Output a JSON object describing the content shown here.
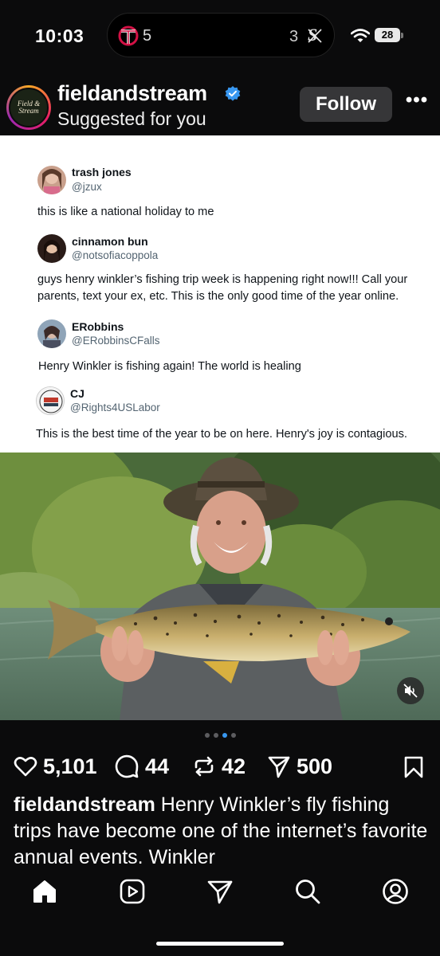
{
  "status_bar": {
    "time": "10:03",
    "live_activity": {
      "left_score": "5",
      "right_score": "3",
      "left_team_icon": "twins-logo-icon",
      "right_team_icon": "white-sox-logo-icon"
    },
    "battery": "28"
  },
  "post": {
    "username": "fieldandstream",
    "subtitle": "Suggested for you",
    "follow_label": "Follow",
    "more_label": "•••",
    "avatar_text": [
      "Field &",
      "Stream"
    ]
  },
  "tweets": [
    {
      "name": "trash jones",
      "handle": "@jzux",
      "text": "this is like a national holiday to me"
    },
    {
      "name": "cinnamon bun",
      "handle": "@notsofiacoppola",
      "text": "guys henry winkler’s fishing trip week is happening right now!!! Call your parents, text your ex, etc. This is the only good time of the year online."
    },
    {
      "name": "ERobbins",
      "handle": "@ERobbinsCFalls",
      "text": "Henry Winkler is fishing again! The world is healing"
    },
    {
      "name": "CJ",
      "handle": "@Rights4USLabor",
      "text": "This is the best time of the year to be on here. Henry's joy is contagious."
    }
  ],
  "carousel": {
    "total": 4,
    "active_index": 2
  },
  "actions": {
    "likes": "5,101",
    "comments": "44",
    "reposts": "42",
    "shares": "500"
  },
  "caption": {
    "username": "fieldandstream",
    "text": "Henry Winkler’s fly fishing trips have become one of the internet’s favorite annual events. Winkler"
  },
  "colors": {
    "background": "#0b0b0c",
    "follow_button": "#363638",
    "verified": "#3897f0",
    "active_dot": "#3897f0"
  },
  "nav": [
    "home-icon",
    "reels-icon",
    "send-icon",
    "search-icon",
    "profile-icon"
  ]
}
